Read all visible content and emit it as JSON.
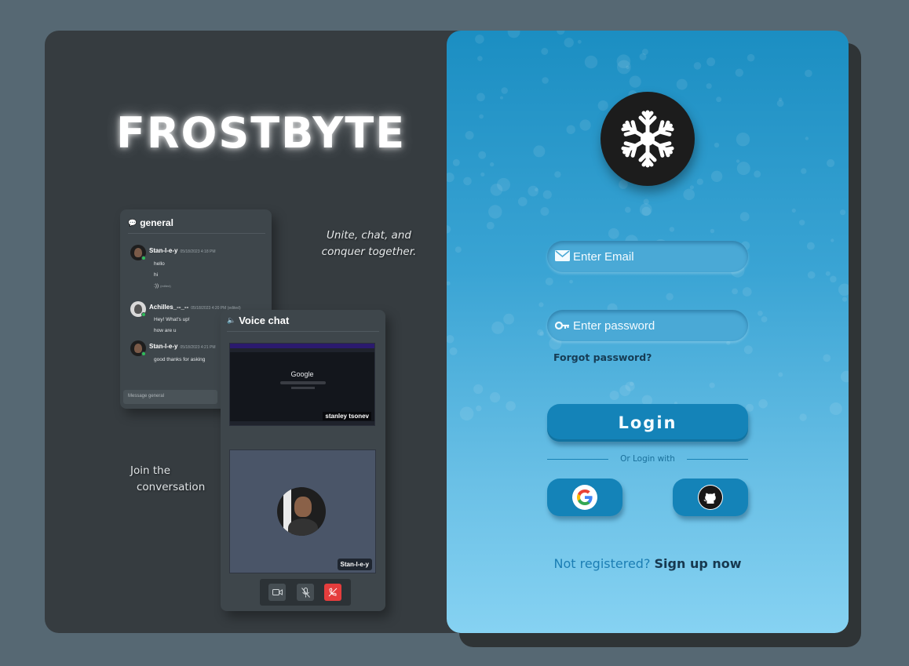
{
  "brand": {
    "name": "FROSTBYTE",
    "tagline": "Unite, chat, and conquer together.",
    "join_line1": "Join the",
    "join_line2": "conversation"
  },
  "chat_preview": {
    "channel": "general",
    "messages": [
      {
        "user": "Stan-l-e-y",
        "time": "05/18/2023 4:18 PM",
        "lines": [
          "hello",
          "hi",
          ":))"
        ],
        "edited_label": "(edited)"
      },
      {
        "user": "Achilles_--_--",
        "time": "05/18/2023 4:20 PM (edited)",
        "lines": [
          "Hey! What's up!",
          "how are u"
        ]
      },
      {
        "user": "Stan-l-e-y",
        "time": "05/18/2023 4:21 PM",
        "lines": [
          "good thanks for asking"
        ]
      }
    ],
    "input_placeholder": "Message general"
  },
  "voice_preview": {
    "title": "Voice chat",
    "screen_share": {
      "search_logo": "Google",
      "user": "stanley tsonev"
    },
    "camera_user": "Stan-l-e-y",
    "controls": [
      "camera-icon",
      "mic-off-icon",
      "hangup-icon"
    ]
  },
  "login": {
    "email_placeholder": "Enter Email",
    "password_placeholder": "Enter password",
    "forgot": "Forgot password?",
    "login_label": "Login",
    "divider": "Or Login with",
    "providers": [
      "google-icon",
      "github-icon"
    ],
    "signup_question": "Not registered?",
    "signup_link": "Sign up now"
  },
  "colors": {
    "page_bg": "#566873",
    "left_panel": "#363c40",
    "card_top": "#1b8ec2",
    "card_bottom": "#86d2f2",
    "button": "#1483b8",
    "end_call": "#e53d3d"
  }
}
